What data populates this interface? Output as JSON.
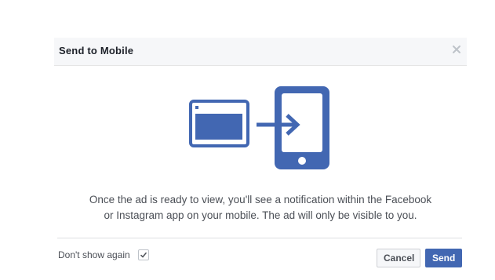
{
  "dialog": {
    "title": "Send to Mobile",
    "close_icon": "close-icon",
    "message_line1": "Once the ad is ready to view, you'll see a notification within the Facebook",
    "message_line2": "or Instagram app on your mobile. The ad will only be visible to you.",
    "dont_show_label": "Don't show again",
    "dont_show_checked": true,
    "cancel_label": "Cancel",
    "send_label": "Send"
  },
  "illustration": {
    "icons": [
      "desktop-window-icon",
      "arrow-right-icon",
      "mobile-phone-icon"
    ]
  },
  "colors": {
    "accent": "#4267b2",
    "header_bg": "#f6f7f9",
    "text": "#4b4f56"
  }
}
